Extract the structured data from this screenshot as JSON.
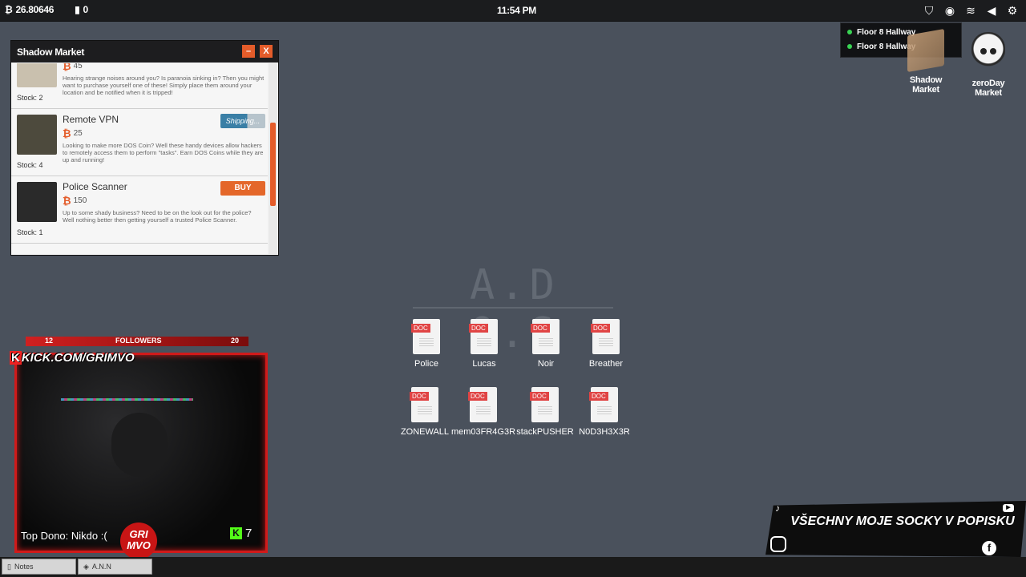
{
  "topbar": {
    "coin_balance": "26.80646",
    "doc_count": "0",
    "clock": "11:54 PM",
    "icons": [
      "shield-icon",
      "signal-icon",
      "wifi-icon",
      "volume-icon",
      "settings-icon"
    ]
  },
  "notifications": [
    {
      "text": "Floor 8 Hallway"
    },
    {
      "text": "Floor 8 Hallway"
    }
  ],
  "desktop_icons": {
    "shadow_market": "Shadow Market",
    "zeroday_market": "zeroDay Market"
  },
  "market": {
    "title": "Shadow Market",
    "minimize": "–",
    "close": "X",
    "products": [
      {
        "name": "",
        "price": "45",
        "desc": "Hearing strange noises around you? Is paranoia sinking in? Then you might want to purchase yourself one of these! Simply place them around your location and be notified when it is tripped!",
        "stock": "Stock: 2",
        "button": ""
      },
      {
        "name": "Remote VPN",
        "price": "25",
        "desc": "Looking to make more DOS Coin? Well these handy devices allow hackers to remotely access them to perform \"tasks\". Earn DOS Coins while they are up and running!",
        "stock": "Stock: 4",
        "button": "Shipping..."
      },
      {
        "name": "Police Scanner",
        "price": "150",
        "desc": "Up to some shady business? Need to be on the look out for the police? Well nothing better then getting yourself a trusted Police Scanner.",
        "stock": "Stock: 1",
        "button": "BUY"
      }
    ]
  },
  "ados": {
    "title": "A.D O.S",
    "docs": [
      "Police",
      "Lucas",
      "Noir",
      "Breather",
      "ZONEWALL",
      "mem03FR4G3R",
      "stackPUSHER",
      "N0D3H3X3R"
    ],
    "doc_tag": "DOC"
  },
  "stream": {
    "followers_left": "12",
    "followers_label": "FOLLOWERS",
    "followers_right": "20",
    "kick_url": "KICK.COM/GRIMVO",
    "top_dono": "Top Dono: Nikdo :(",
    "logo_text": "GRI MVO",
    "viewer_count": "7"
  },
  "social": {
    "banner": "VŠECHNY MOJE SOCKY V POPISKU"
  },
  "taskbar": {
    "items": [
      "Notes",
      "A.N.N"
    ]
  }
}
